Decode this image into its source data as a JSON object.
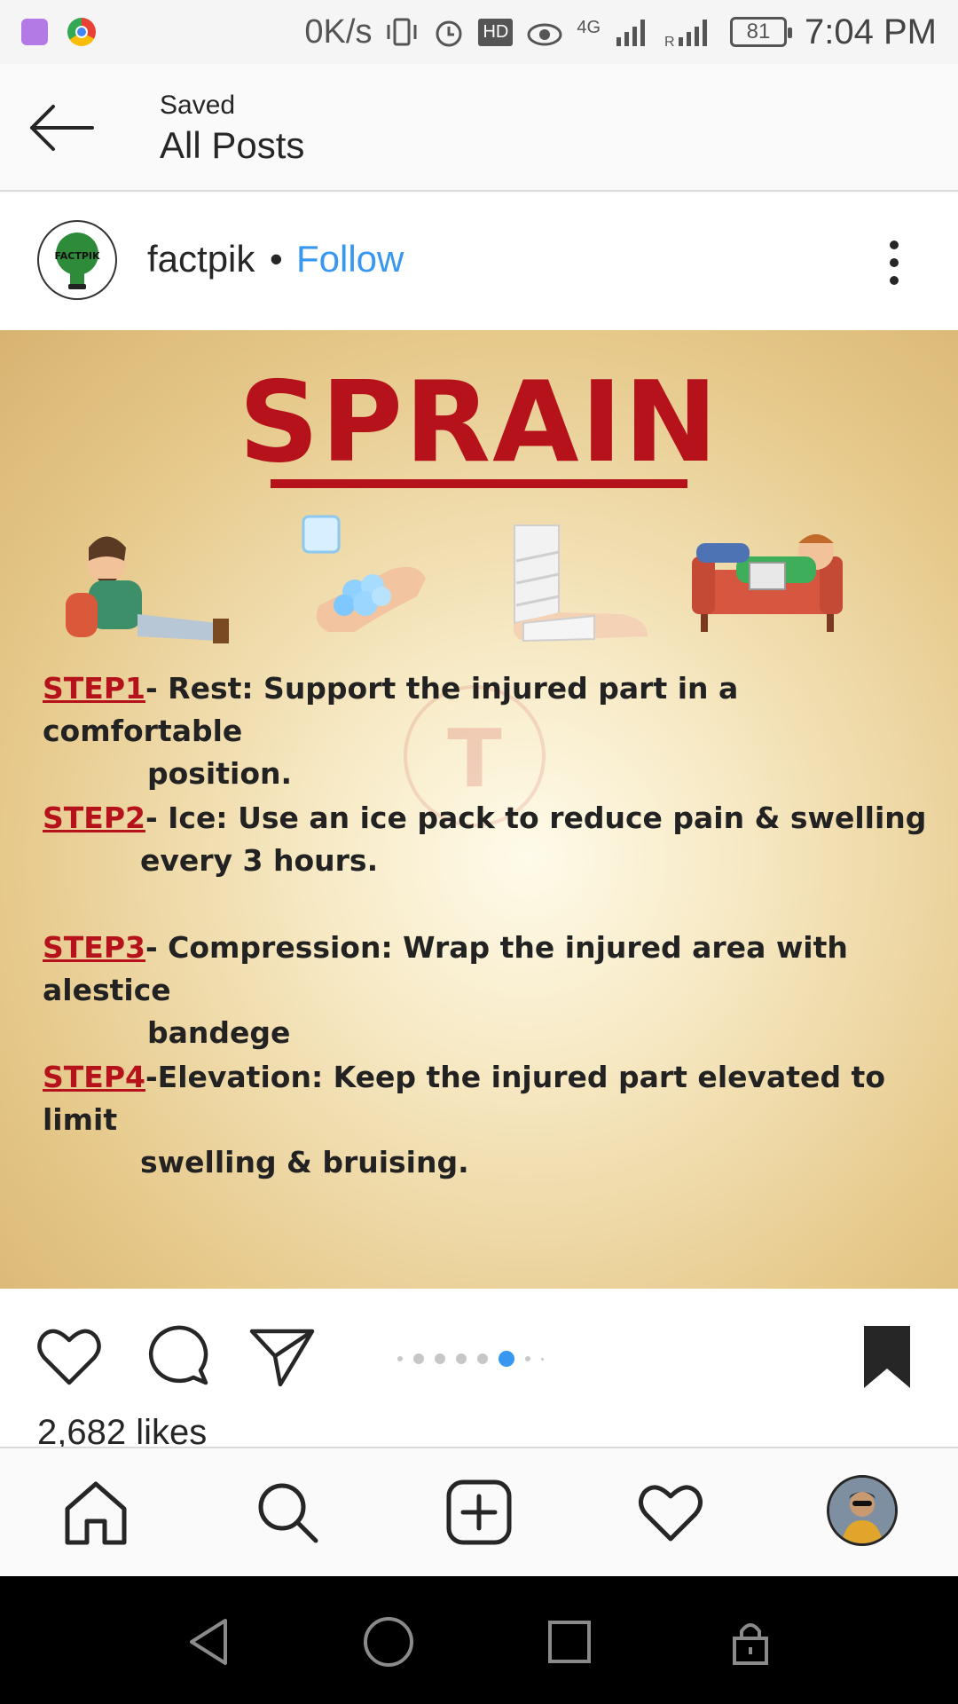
{
  "status_bar": {
    "net_speed": "0K/s",
    "hd_badge": "HD",
    "network_type": "4G",
    "battery": "81",
    "time": "7:04 PM"
  },
  "header": {
    "subtitle": "Saved",
    "title": "All Posts"
  },
  "post": {
    "username": "factpik",
    "separator": "•",
    "follow_label": "Follow",
    "avatar_text": "FACTPIK",
    "image": {
      "title": "SPRAIN",
      "watermark": "T",
      "steps": [
        {
          "label": "STEP1",
          "dash": "- ",
          "text": "Rest: Support the injured part in a comfortable",
          "cont": "position."
        },
        {
          "label": "STEP2",
          "dash": "- ",
          "text": "Ice: Use an ice pack to reduce pain & swelling",
          "cont": "every 3 hours."
        },
        {
          "label": "STEP3",
          "dash": "- ",
          "text": "Compression: Wrap the injured area with alestice",
          "cont": "bandege"
        },
        {
          "label": "STEP4",
          "dash": "-",
          "text": "Elevation: Keep the injured part elevated to limit",
          "cont": "swelling & bruising."
        }
      ]
    },
    "carousel": {
      "total_dots": 8,
      "active_index": 5
    },
    "likes": "2,682 likes"
  },
  "colors": {
    "accent": "#3897f0",
    "title_red": "#b5121b",
    "text": "#262626"
  },
  "icons": {
    "back": "arrow-left-icon",
    "more": "more-vertical-icon",
    "like": "heart-icon",
    "comment": "comment-icon",
    "share": "send-icon",
    "save": "bookmark-filled-icon",
    "home": "home-icon",
    "search": "search-icon",
    "add": "add-post-icon",
    "activity": "heart-icon",
    "profile": "profile-avatar"
  }
}
